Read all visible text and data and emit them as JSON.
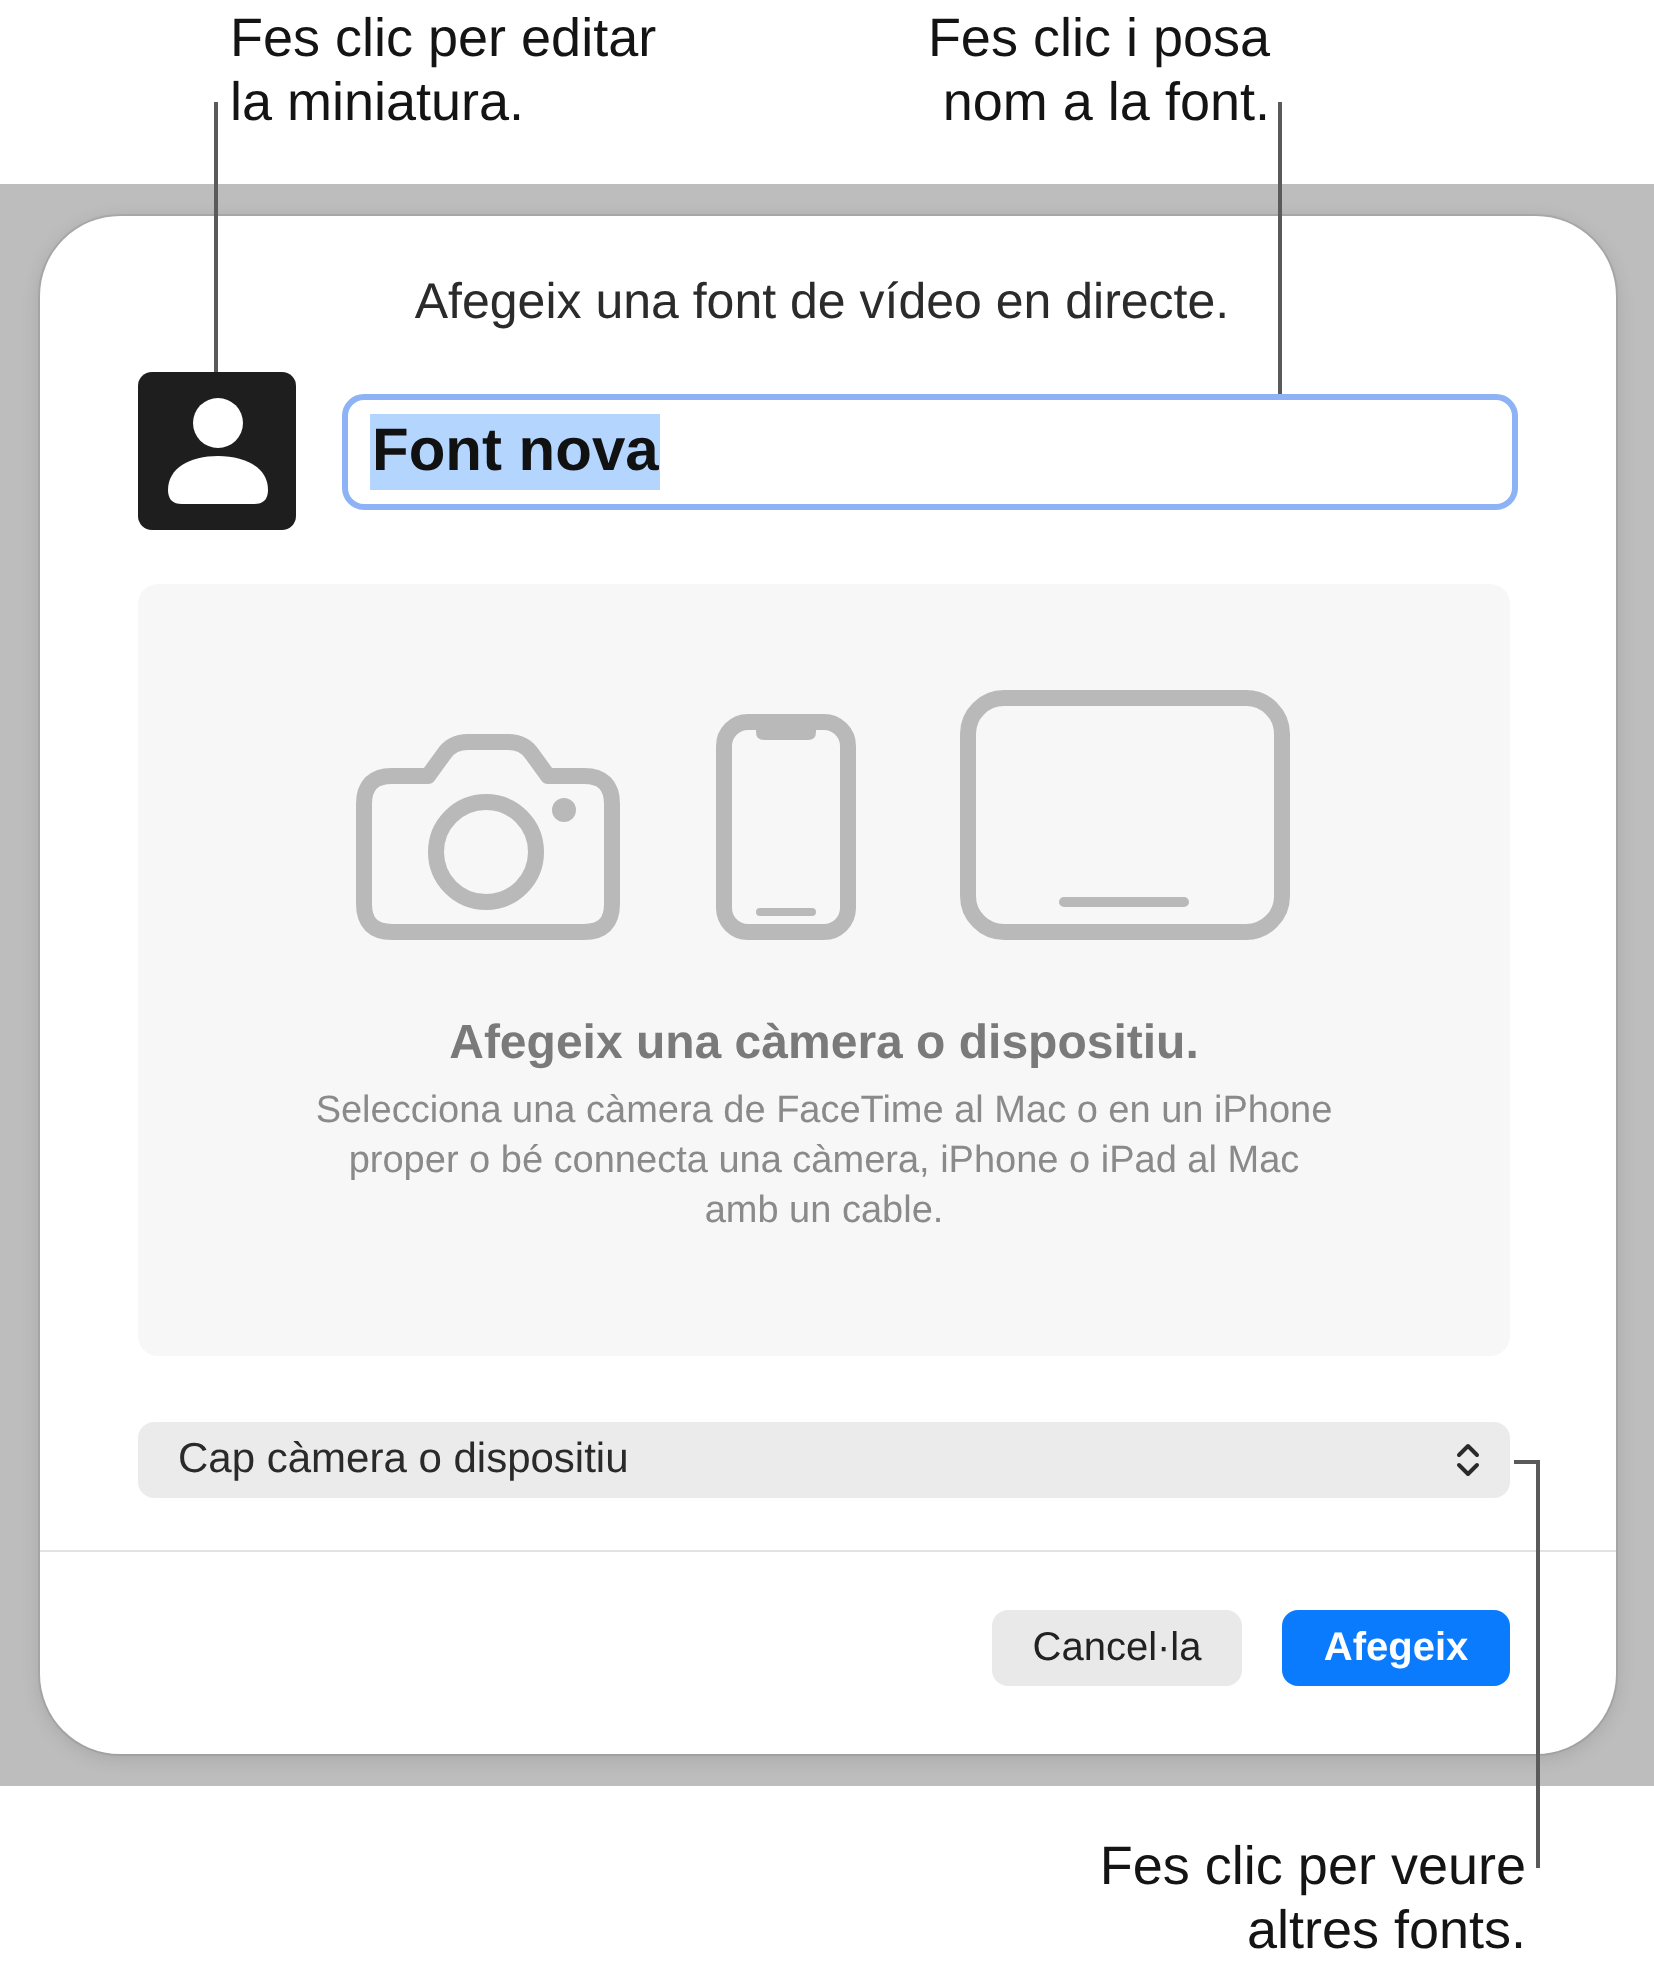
{
  "callouts_top": [
    {
      "lines": [
        "Fes clic per editar",
        "la miniatura."
      ]
    },
    {
      "lines": [
        "Fes clic i posa",
        "nom a la font."
      ]
    }
  ],
  "dialog": {
    "title": "Afegeix una font de vídeo en directe.",
    "name_field": {
      "value": "Font nova",
      "focused": true,
      "text_selected": true
    },
    "preview": {
      "heading": "Afegeix una càmera o dispositiu.",
      "description_lines": [
        "Selecciona una càmera de FaceTime al Mac o en un iPhone",
        "proper o bé connecta una càmera, iPhone o iPad al Mac",
        "amb un cable."
      ]
    },
    "device_popup": {
      "value": "Cap càmera o dispositiu"
    },
    "buttons": [
      {
        "label": "Cancel·la",
        "kind": "secondary"
      },
      {
        "label": "Afegeix",
        "kind": "primary"
      }
    ]
  },
  "callouts_bottom": [
    {
      "lines": [
        "Fes clic per veure",
        "altres fonts."
      ]
    }
  ]
}
